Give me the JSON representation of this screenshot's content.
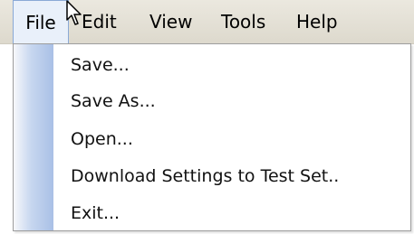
{
  "menubar": {
    "items": [
      {
        "label": "File"
      },
      {
        "label": "Edit"
      },
      {
        "label": "View"
      },
      {
        "label": "Tools"
      },
      {
        "label": "Help"
      }
    ]
  },
  "file_menu": {
    "items": [
      {
        "label": "Save..."
      },
      {
        "label": "Save As..."
      },
      {
        "label": "Open..."
      },
      {
        "label": "Download Settings to Test Set.."
      },
      {
        "label": "Exit..."
      }
    ]
  },
  "colors": {
    "menubar_bg": "#e3e0d6",
    "active_menu_bg": "#e9f0fa",
    "gutter": "#a9c0e6",
    "text": "#000000"
  },
  "icons": {
    "cursor": "mouse-pointer-icon"
  }
}
